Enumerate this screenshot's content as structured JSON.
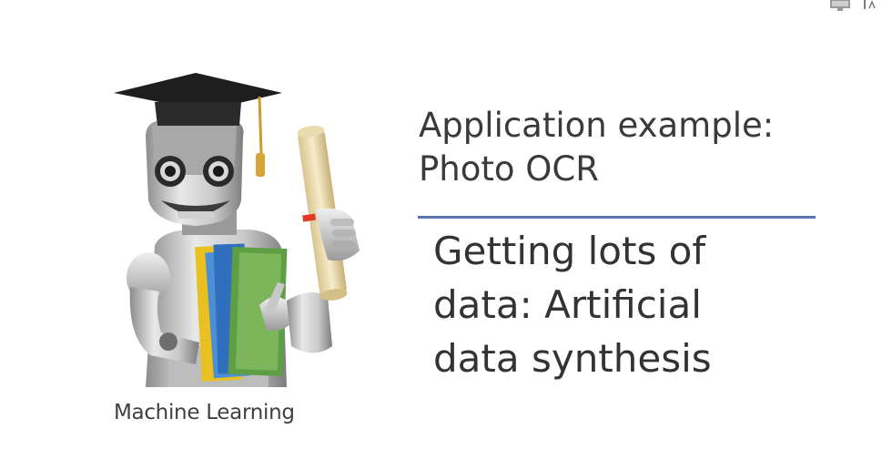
{
  "slide": {
    "title_lines": [
      "Application example:",
      "Photo OCR"
    ],
    "subtitle_lines": [
      "Getting lots of",
      "data: Artificial",
      "data synthesis"
    ],
    "caption": "Machine Learning",
    "accent_color": "#5b74b4"
  },
  "icons": {
    "robot": "robot-graduate-illustration",
    "corner": "screen-share-icon"
  }
}
